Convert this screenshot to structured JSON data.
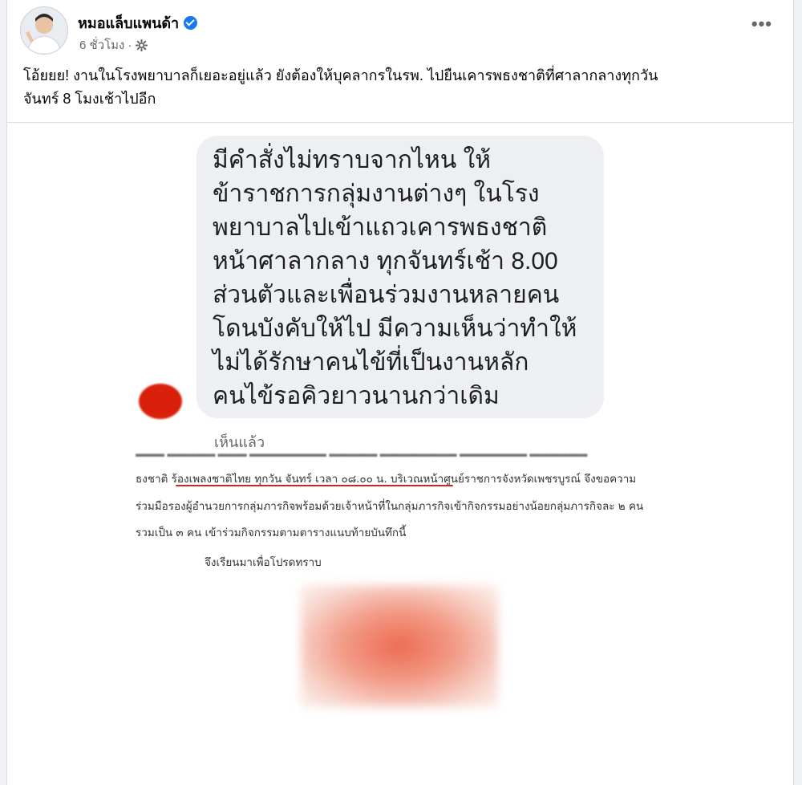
{
  "post": {
    "author": "หมอแล็บแพนด้า",
    "time": "6 ชั่วโมง ·",
    "more_label": "•••",
    "caption_line1": "โอ้ยยย! งานในโรงพยาบาลก็เยอะอยู่แล้ว ยังต้องให้บุคลากรในรพ. ไปยืนเคารพธงชาติที่ศาลากลางทุกวัน",
    "caption_line2": "จันทร์ 8 โมงเช้าไปอีก"
  },
  "message": {
    "lines": [
      "มีคำสั่งไม่ทราบจากไหน ให้",
      "ข้าราชการกลุ่มงานต่างๆ ในโรง",
      "พยาบาลไปเข้าแถวเคารพธงชาติ",
      "หน้าศาลากลาง ทุกจันทร์เช้า 8.00",
      "ส่วนตัวและเพื่อนร่วมงานหลายคน",
      "โดนบังคับให้ไป มีความเห็นว่าทำให้",
      "ไม่ได้รักษาคนไข้ที่เป็นงานหลัก",
      "คนไข้รอคิวยาวนานกว่าเดิม"
    ],
    "seen_label": "เห็นแล้ว"
  },
  "document": {
    "line1": "ธงชาติ ร้องเพลงชาติไทย ทุกวัน จันทร์ เวลา ๐๘.๐๐ น. บริเวณหน้าศูนย์ราชการจังหวัดเพชรบูรณ์ จึงขอความ",
    "line2": "ร่วมมือรองผู้อำนวยการกลุ่มภารกิจพร้อมด้วยเจ้าหน้าที่ในกลุ่มภารกิจเข้ากิจกรรมอย่างน้อยกลุ่มภารกิจละ ๒ คน",
    "line3": "รวมเป็น ๓ คน เข้าร่วมกิจกรรมตามตารางแนบท้ายบันทึกนี้",
    "line4": "จึงเรียนมาเพื่อโปรดทราบ"
  },
  "colors": {
    "verified": "#1877f2",
    "underline": "#c62828",
    "redaction": "#d8200b"
  },
  "icons": [
    "verified-badge-icon",
    "gear-icon",
    "more-options-icon"
  ]
}
